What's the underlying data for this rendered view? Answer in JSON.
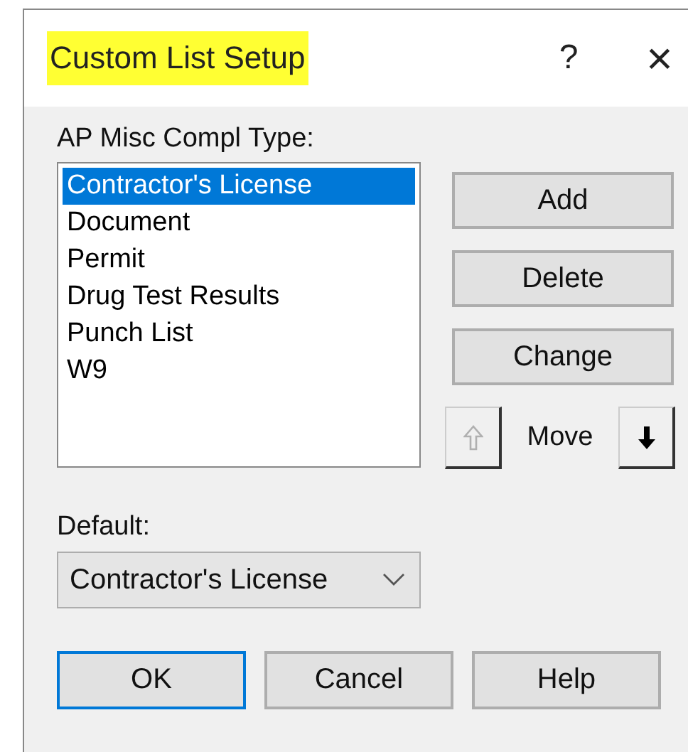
{
  "window": {
    "title": "Custom List Setup",
    "title_highlighted": true,
    "help_glyph": "?",
    "close_glyph": "×"
  },
  "list": {
    "label": "AP Misc Compl Type:",
    "items": [
      {
        "text": "Contractor's License",
        "selected": true
      },
      {
        "text": "Document",
        "selected": false
      },
      {
        "text": "Permit",
        "selected": false
      },
      {
        "text": "Drug Test Results",
        "selected": false
      },
      {
        "text": "Punch List",
        "selected": false
      },
      {
        "text": "W9",
        "selected": false
      }
    ]
  },
  "side_buttons": [
    "Add",
    "Delete",
    "Change"
  ],
  "move": {
    "label": "Move",
    "up_disabled": true,
    "down_disabled": false
  },
  "default": {
    "label": "Default:",
    "value": "Contractor's License"
  },
  "buttons": [
    {
      "label": "OK",
      "default": true
    },
    {
      "label": "Cancel",
      "default": false
    },
    {
      "label": "Help",
      "default": false
    }
  ]
}
